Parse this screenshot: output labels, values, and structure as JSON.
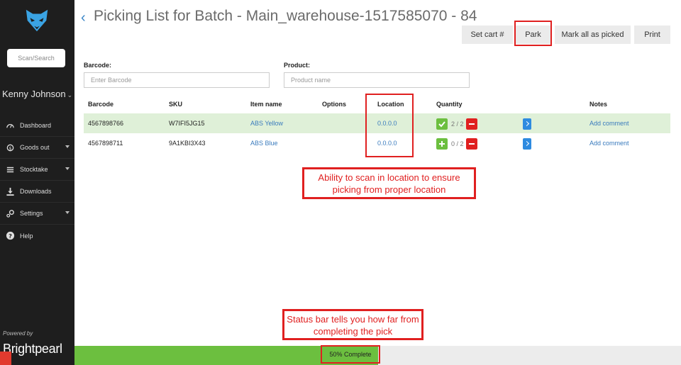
{
  "sidebar": {
    "scan_search": "Scan/Search",
    "user_name": "Kenny Johnson",
    "nav": [
      {
        "label": "Dashboard",
        "icon": "dashboard-icon"
      },
      {
        "label": "Goods out",
        "icon": "goods-out-icon"
      },
      {
        "label": "Stocktake",
        "icon": "stocktake-icon"
      },
      {
        "label": "Downloads",
        "icon": "download-icon"
      },
      {
        "label": "Settings",
        "icon": "settings-icon"
      },
      {
        "label": "Help",
        "icon": "help-icon"
      }
    ],
    "powered_by": "Powered by",
    "brand": "Brightpearl"
  },
  "header": {
    "title": "Picking List for Batch - Main_warehouse-1517585070 - 84",
    "buttons": {
      "set_cart": "Set cart #",
      "park": "Park",
      "mark_all": "Mark all as picked",
      "print": "Print"
    }
  },
  "form": {
    "barcode_label": "Barcode:",
    "barcode_placeholder": "Enter Barcode",
    "product_label": "Product:",
    "product_placeholder": "Product name"
  },
  "table": {
    "headers": {
      "barcode": "Barcode",
      "sku": "SKU",
      "item_name": "Item name",
      "options": "Options",
      "location": "Location",
      "quantity": "Quantity",
      "notes": "Notes"
    },
    "rows": [
      {
        "barcode": "4567898766",
        "sku": "W7IFI5JG15",
        "item_name": "ABS Yellow",
        "options": "",
        "location": "0.0.0.0",
        "qty": "2 / 2",
        "notes": "Add comment"
      },
      {
        "barcode": "4567898711",
        "sku": "9A1KBI3X43",
        "item_name": "ABS Blue",
        "options": "",
        "location": "0.0.0.0",
        "qty": "0 / 2",
        "notes": "Add comment"
      }
    ]
  },
  "callouts": {
    "location": "Ability to scan in location to ensure picking from proper location",
    "status": "Status bar tells you how far from completing the pick"
  },
  "status": {
    "label": "50% Complete",
    "progress": 0.5
  },
  "colors": {
    "sidebar_bg": "#1e1e1e",
    "accent_blue": "#3a86c8",
    "success_green": "#6cbf3f",
    "danger_red": "#e02020"
  }
}
